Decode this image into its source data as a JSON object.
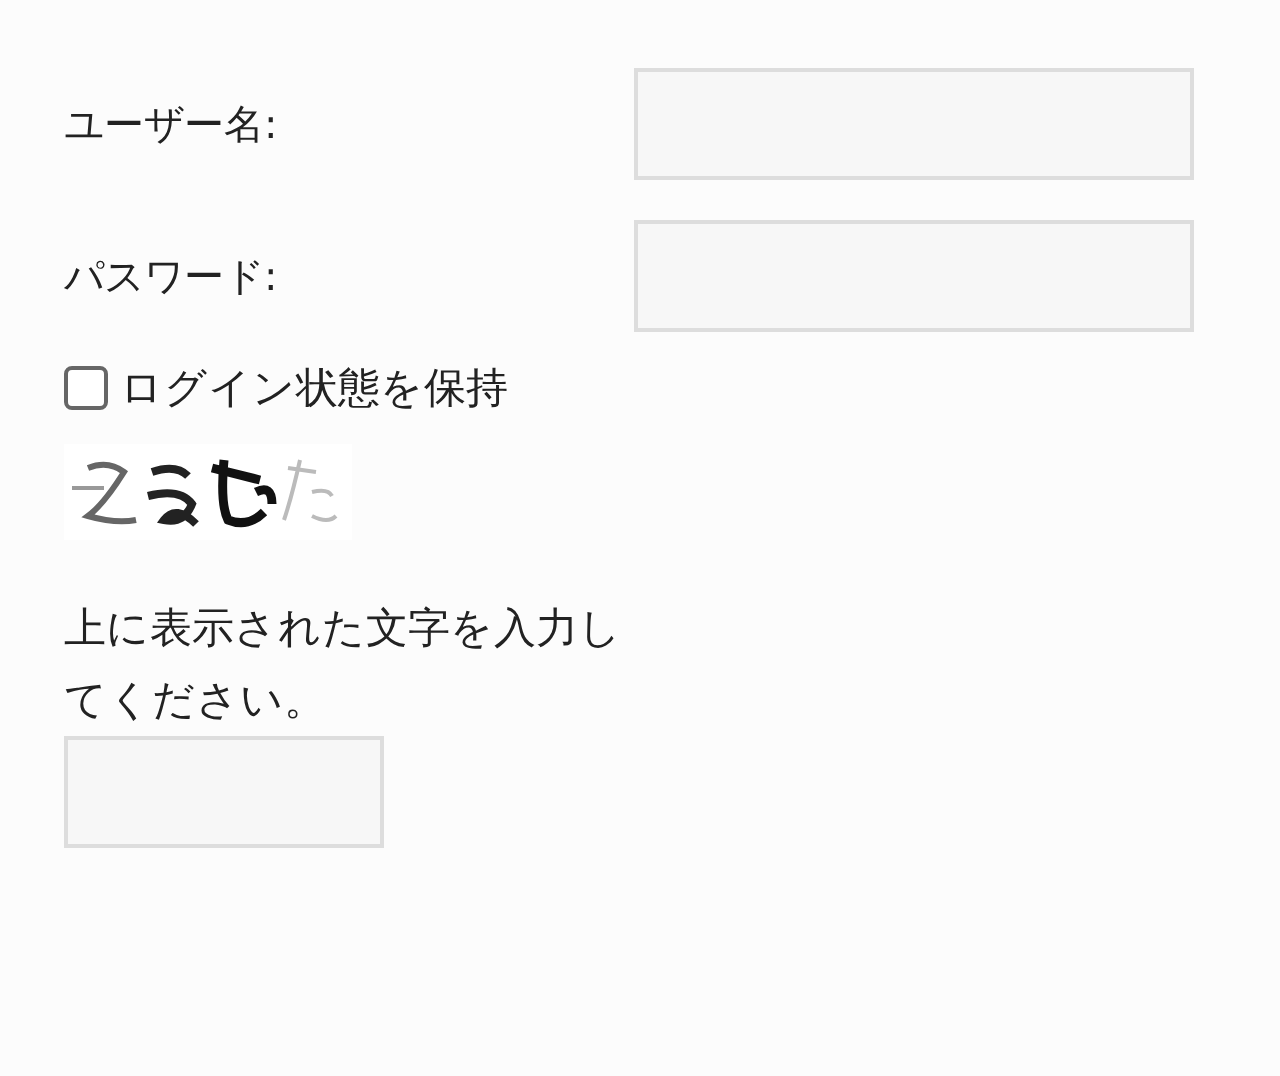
{
  "fields": [
    {
      "label": "ユーザー名:"
    },
    {
      "label": "パスワード:"
    }
  ],
  "remember": {
    "label": "ログイン状態を保持",
    "checked": false
  },
  "captcha_prompt": "上に表示された文字を入力してください。"
}
